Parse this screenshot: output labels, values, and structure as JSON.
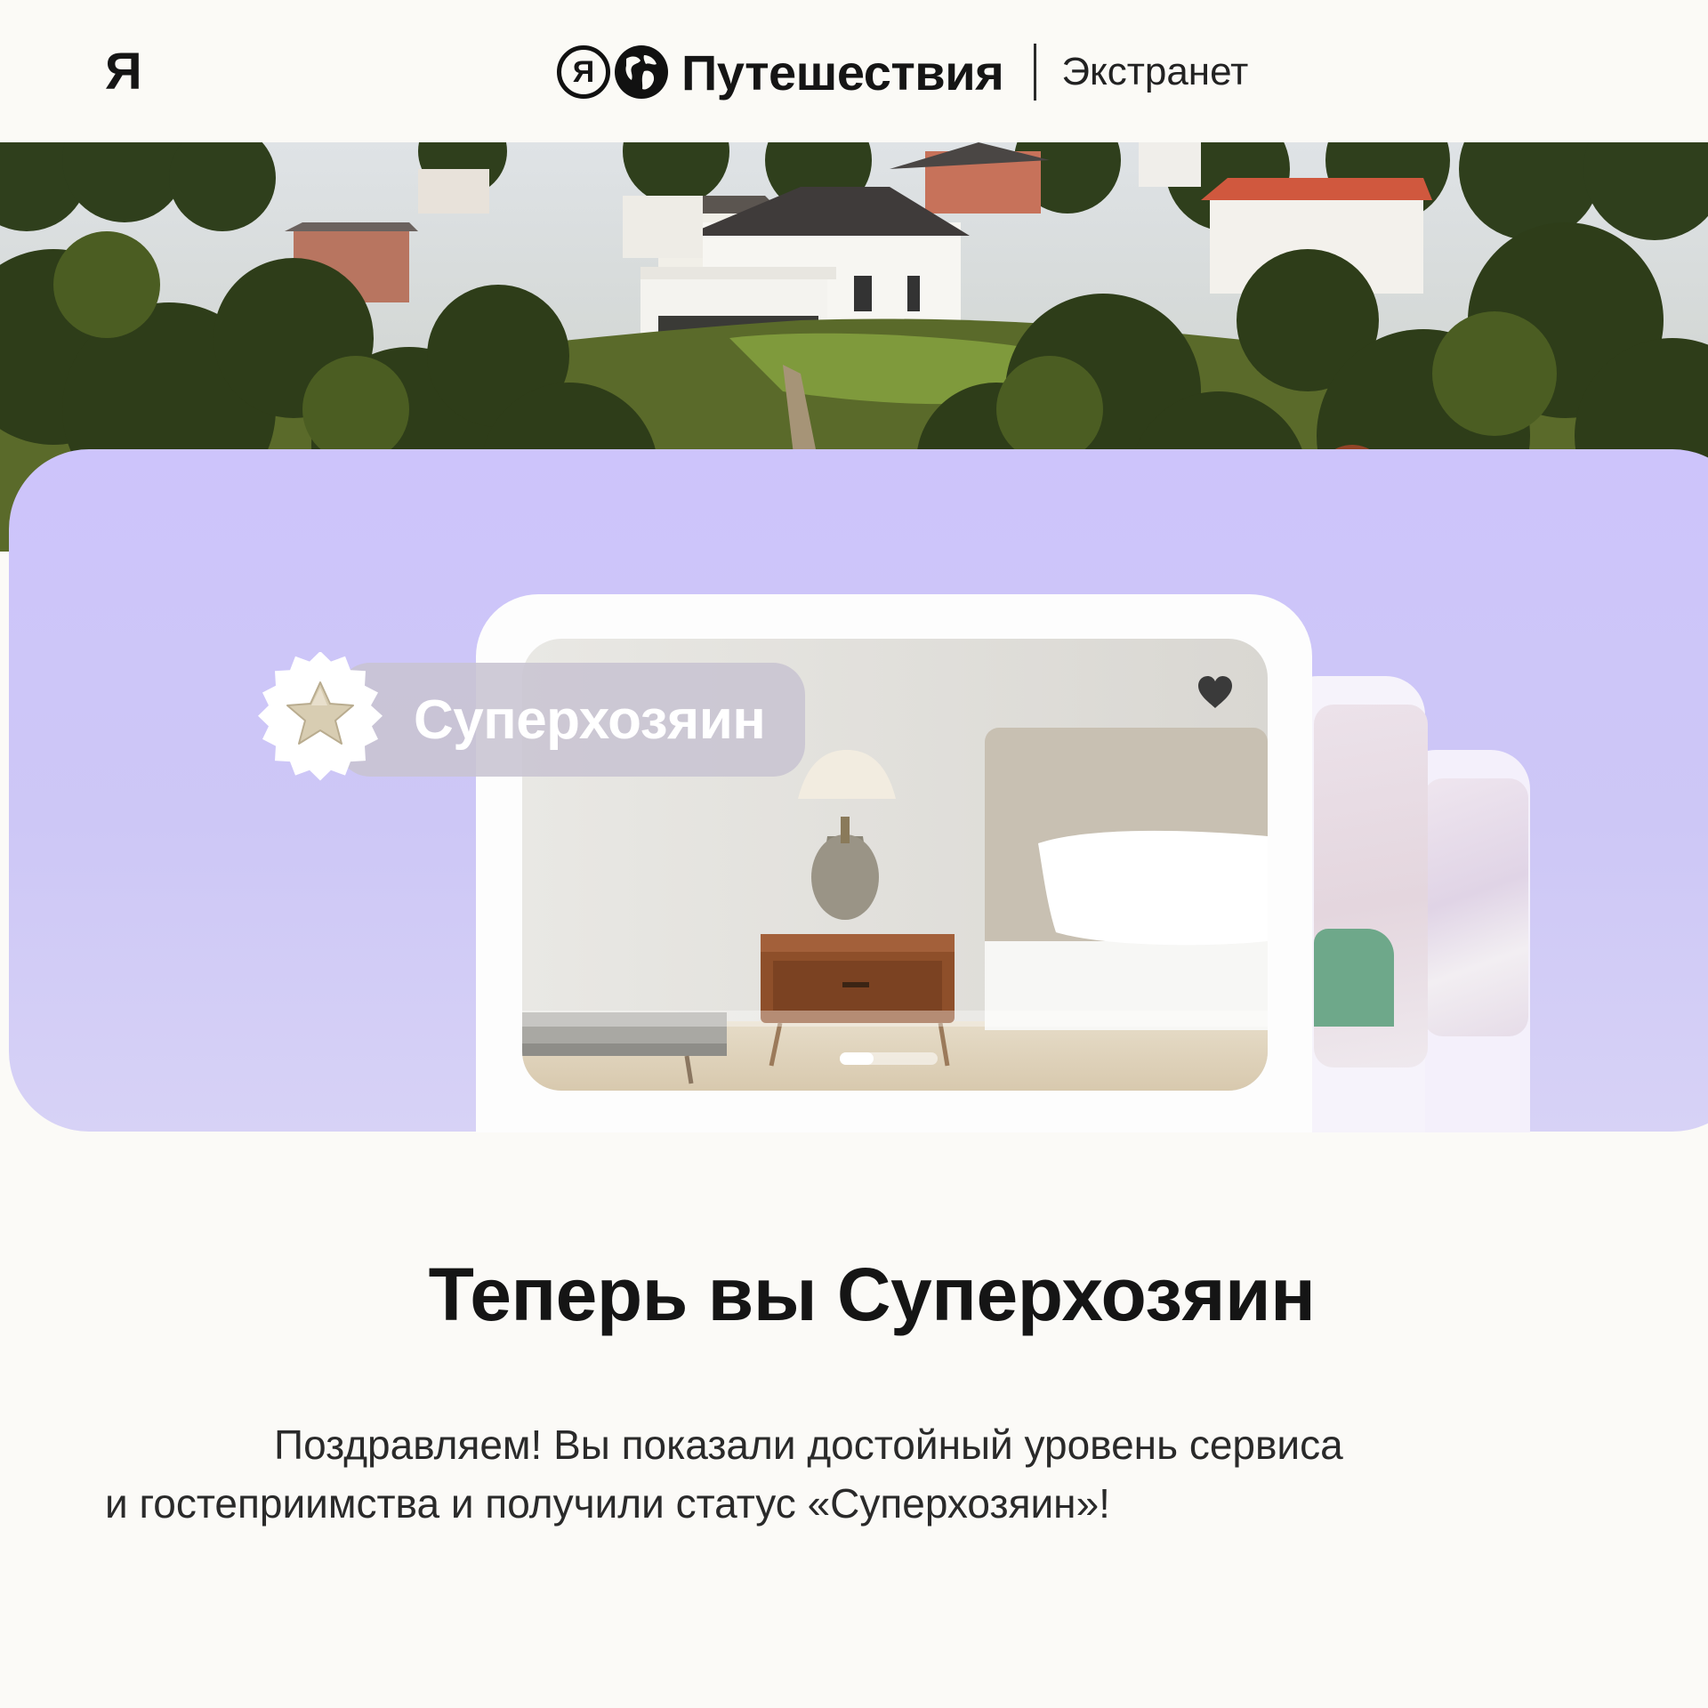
{
  "header": {
    "ya_mark": "Я",
    "brand_letter": "Я",
    "brand_name": "Путешествия",
    "brand_sub": "Экстранет"
  },
  "badge": {
    "label": "Суперхозяин"
  },
  "content": {
    "title": "Теперь вы Суперхозяин",
    "body_line1": "Поздравляем! Вы показали достойный уровень сервиса",
    "body_line2": "и гостеприимства и получили статус «Суперхозяин»!"
  },
  "colors": {
    "panel_lavender": "#cdc4fb",
    "page_background": "#fbfaf7",
    "text_primary": "#151515"
  },
  "icons": [
    "yandex-logo-icon",
    "globe-icon",
    "star-seal-icon",
    "heart-icon"
  ]
}
